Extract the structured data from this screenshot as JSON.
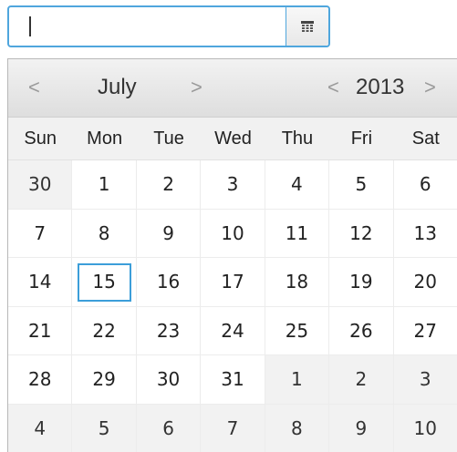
{
  "date_field": {
    "value": "",
    "placeholder": ""
  },
  "calendar_button": {
    "icon": "calendar-icon"
  },
  "navigation": {
    "prev_month_label": "<",
    "month": "July",
    "next_month_label": ">",
    "prev_year_label": "<",
    "year": "2013",
    "next_year_label": ">"
  },
  "weekdays": [
    "Sun",
    "Mon",
    "Tue",
    "Wed",
    "Thu",
    "Fri",
    "Sat"
  ],
  "weeks": [
    [
      {
        "day": "30",
        "current_month": false
      },
      {
        "day": "1",
        "current_month": true
      },
      {
        "day": "2",
        "current_month": true
      },
      {
        "day": "3",
        "current_month": true
      },
      {
        "day": "4",
        "current_month": true
      },
      {
        "day": "5",
        "current_month": true
      },
      {
        "day": "6",
        "current_month": true
      }
    ],
    [
      {
        "day": "7",
        "current_month": true
      },
      {
        "day": "8",
        "current_month": true
      },
      {
        "day": "9",
        "current_month": true
      },
      {
        "day": "10",
        "current_month": true
      },
      {
        "day": "11",
        "current_month": true
      },
      {
        "day": "12",
        "current_month": true
      },
      {
        "day": "13",
        "current_month": true
      }
    ],
    [
      {
        "day": "14",
        "current_month": true
      },
      {
        "day": "15",
        "current_month": true,
        "selected": true
      },
      {
        "day": "16",
        "current_month": true
      },
      {
        "day": "17",
        "current_month": true
      },
      {
        "day": "18",
        "current_month": true
      },
      {
        "day": "19",
        "current_month": true
      },
      {
        "day": "20",
        "current_month": true
      }
    ],
    [
      {
        "day": "21",
        "current_month": true
      },
      {
        "day": "22",
        "current_month": true
      },
      {
        "day": "23",
        "current_month": true
      },
      {
        "day": "24",
        "current_month": true
      },
      {
        "day": "25",
        "current_month": true
      },
      {
        "day": "26",
        "current_month": true
      },
      {
        "day": "27",
        "current_month": true
      }
    ],
    [
      {
        "day": "28",
        "current_month": true
      },
      {
        "day": "29",
        "current_month": true
      },
      {
        "day": "30",
        "current_month": true
      },
      {
        "day": "31",
        "current_month": true
      },
      {
        "day": "1",
        "current_month": false
      },
      {
        "day": "2",
        "current_month": false
      },
      {
        "day": "3",
        "current_month": false
      }
    ],
    [
      {
        "day": "4",
        "current_month": false
      },
      {
        "day": "5",
        "current_month": false
      },
      {
        "day": "6",
        "current_month": false
      },
      {
        "day": "7",
        "current_month": false
      },
      {
        "day": "8",
        "current_month": false
      },
      {
        "day": "9",
        "current_month": false
      },
      {
        "day": "10",
        "current_month": false
      }
    ]
  ],
  "colors": {
    "focus_border": "#4fa6dd",
    "selected_outline": "#3c9ed9",
    "other_month_background": "#f2f2f2",
    "header_background": "#f1f1f1"
  }
}
